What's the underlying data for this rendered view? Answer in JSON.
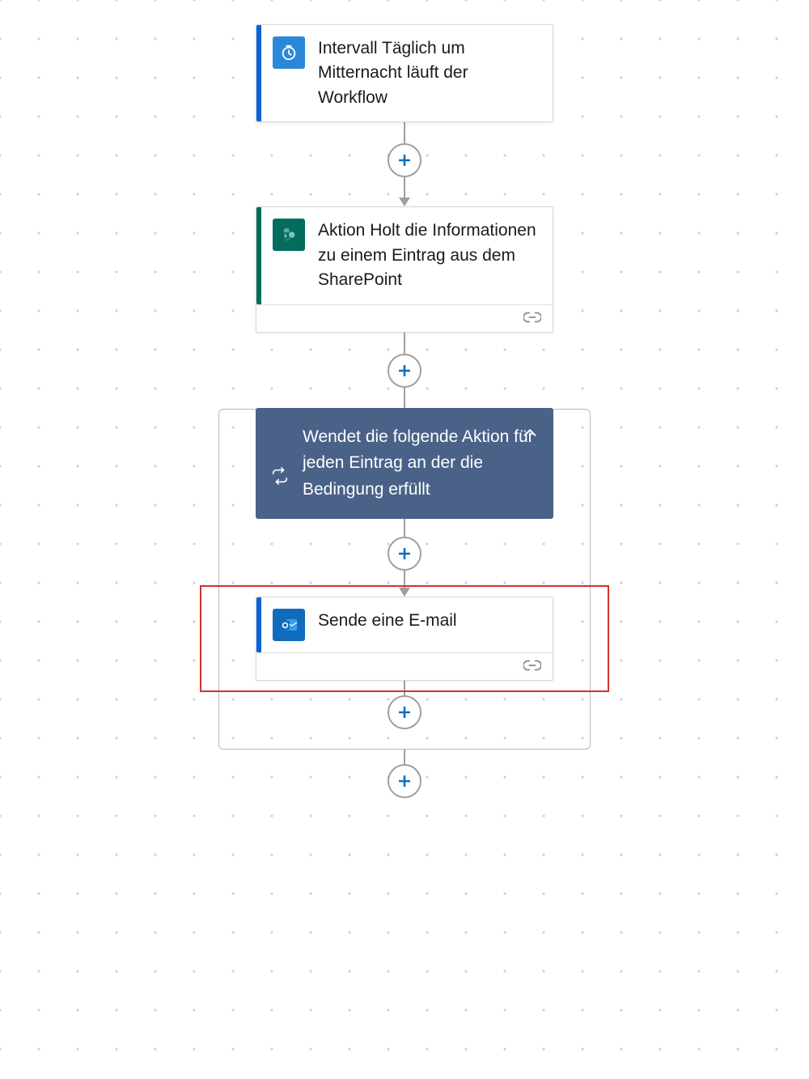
{
  "nodes": {
    "trigger": {
      "title": "Intervall Täglich um Mitternacht läuft der Workflow",
      "icon": "clock-icon",
      "accent": "#0b62db"
    },
    "sharepoint": {
      "title": "Aktion Holt die Informationen zu einem Eintrag aus dem SharePoint",
      "icon": "sharepoint-icon",
      "accent": "#036c5f"
    },
    "loop": {
      "title": "Wendet die folgende Aktion für jeden Eintrag an der die Bedingung erfüllt",
      "icon": "loop-icon"
    },
    "email": {
      "title": "Sende eine E-mail",
      "icon": "outlook-icon",
      "accent": "#0b62db"
    }
  },
  "highlight": {
    "target": "email-node"
  }
}
